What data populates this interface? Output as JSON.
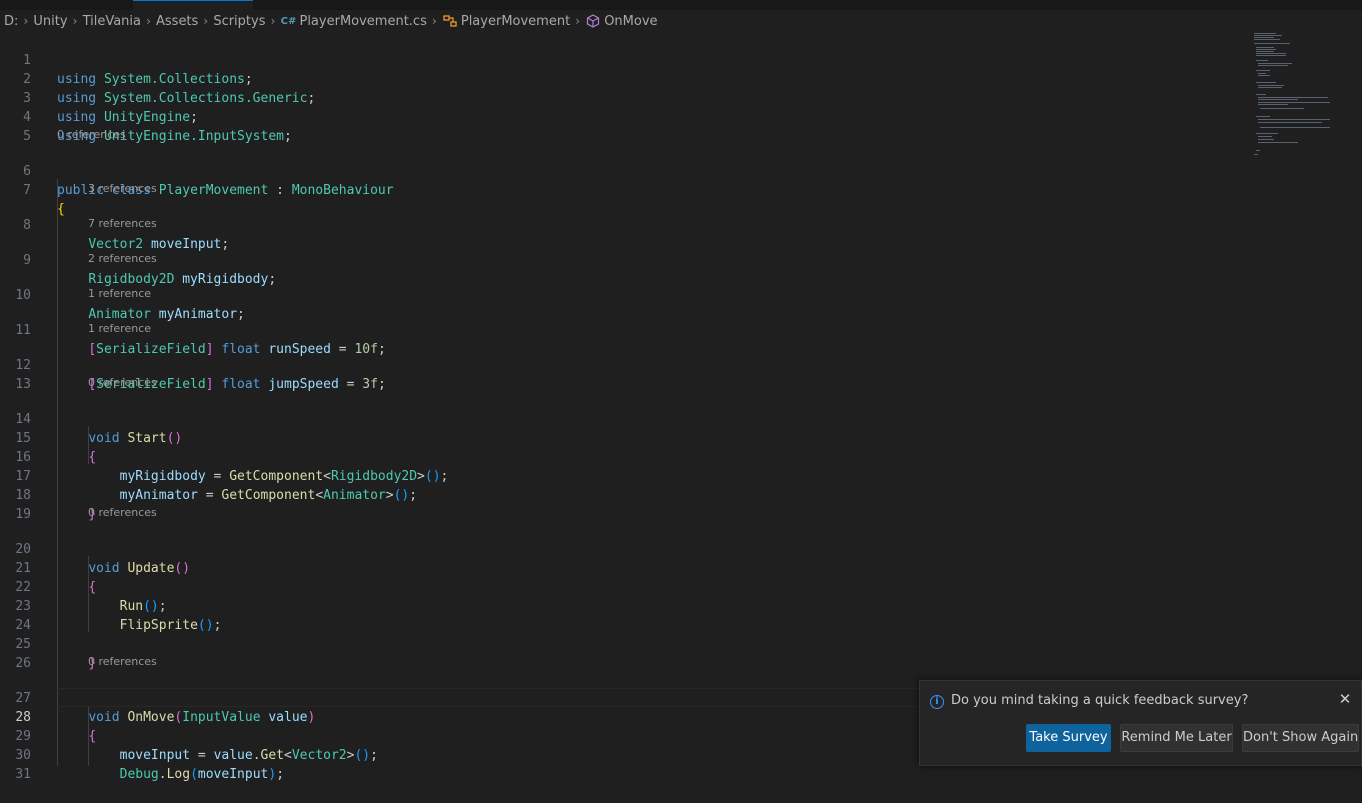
{
  "breadcrumb": {
    "drive": "D:",
    "items": [
      "Unity",
      "TileVania",
      "Assets",
      "Scriptys"
    ],
    "file": "PlayerMovement.cs",
    "class": "PlayerMovement",
    "method": "OnMove",
    "icons": {
      "file": "csharp-file-icon",
      "class": "class-icon",
      "method": "method-cube-icon",
      "separator": "chevron-right-icon"
    }
  },
  "lenses": {
    "class_refs": "0 references",
    "moveInput_refs": "3 references",
    "myRigidbody_refs": "7 references",
    "myAnimator_refs": "2 references",
    "runSpeed_refs": "1 reference",
    "jumpSpeed_refs": "1 reference",
    "start_refs": "0 references",
    "update_refs": "0 references",
    "onmove_refs": "0 references"
  },
  "line_numbers": [
    "1",
    "2",
    "3",
    "4",
    "5",
    "6",
    "7",
    "8",
    "9",
    "10",
    "11",
    "12",
    "13",
    "14",
    "15",
    "16",
    "17",
    "18",
    "19",
    "20",
    "21",
    "22",
    "23",
    "24",
    "25",
    "26",
    "27",
    "28",
    "29",
    "30",
    "31"
  ],
  "current_line": "28",
  "code": {
    "using": "using",
    "ns1": "System.Collections",
    "ns2": "System.Collections.Generic",
    "ns3": "UnityEngine",
    "ns4": "UnityEngine.InputSystem",
    "public": "public",
    "class": "class",
    "classname": "PlayerMovement",
    "base": "MonoBehaviour",
    "vector2": "Vector2",
    "moveInput": "moveInput",
    "rigidbody2d": "Rigidbody2D",
    "myRigidbody": "myRigidbody",
    "animator": "Animator",
    "myAnimator": "myAnimator",
    "serializefield": "SerializeField",
    "float": "float",
    "runSpeed": "runSpeed",
    "runSpeedVal": "10f",
    "jumpSpeed": "jumpSpeed",
    "jumpSpeedVal": "3f",
    "void": "void",
    "start": "Start",
    "getcomponent": "GetComponent",
    "update": "Update",
    "run": "Run",
    "flipsprite": "FlipSprite",
    "onmove": "OnMove",
    "inputvalue": "InputValue",
    "value": "value",
    "get": "Get",
    "debug": "Debug",
    "log": "Log"
  },
  "notification": {
    "message": "Do you mind taking a quick feedback survey?",
    "take_survey": "Take Survey",
    "remind_later": "Remind Me Later",
    "dont_show": "Don't Show Again",
    "info_icon": "info-icon",
    "close_icon": "close-icon"
  },
  "colors": {
    "editor_bg": "#1f1f1f",
    "keyword": "#569cd6",
    "type": "#4ec9b0",
    "function": "#dcdcaa",
    "variable": "#9cdcfe",
    "number": "#b5cea8",
    "primary_button": "#0e639c"
  }
}
